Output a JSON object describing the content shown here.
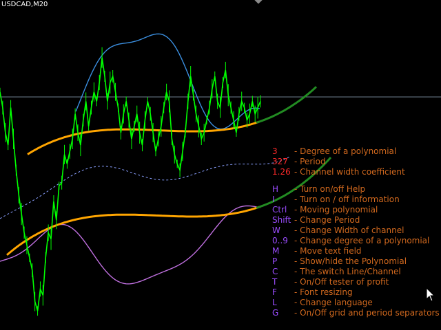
{
  "symbol": "USDCAD,M20",
  "params": [
    {
      "key": "3",
      "desc": "- Degree of a polynomial"
    },
    {
      "key": "327",
      "desc": "- Period"
    },
    {
      "key": "1.26",
      "desc": "- Channel width coefficient"
    }
  ],
  "help": [
    {
      "key": "H",
      "desc": "- Turn on/off Help"
    },
    {
      "key": "I",
      "desc": "- Turn on / off information"
    },
    {
      "key": "Ctrl",
      "desc": "- Moving polynomial"
    },
    {
      "key": "Shift",
      "desc": "- Change Period"
    },
    {
      "key": "W",
      "desc": "- Change Width of channel"
    },
    {
      "key": "0..9",
      "desc": "- Change degree of a polynomial"
    },
    {
      "key": "M",
      "desc": "- Move text field"
    },
    {
      "key": "P",
      "desc": "- Show/hide the Polynomial"
    },
    {
      "key": "C",
      "desc": "- The switch Line/Channel"
    },
    {
      "key": "T",
      "desc": "- On/Off tester of profit"
    },
    {
      "key": "F",
      "desc": "- Font resizing"
    },
    {
      "key": "L",
      "desc": "- Change language"
    },
    {
      "key": "G",
      "desc": "- On/Off grid and period separators"
    }
  ],
  "colors": {
    "background": "#000000",
    "price": "#00ff00",
    "channel": "#ffa500",
    "extension": "#228b22",
    "envelope_upper": "#3b8fe0",
    "envelope_lower": "#c070e0",
    "midline": "#8aa0ff",
    "param_key": "#ff2a2a",
    "help_key": "#9b4dff",
    "help_text": "#d2691e",
    "level_line": "#708090"
  },
  "chart_data": {
    "type": "line",
    "series": [
      {
        "values": [
          0.75,
          0.7,
          0.62,
          0.58,
          0.7,
          0.6,
          0.5,
          0.42,
          0.36,
          0.3,
          0.26,
          0.22,
          0.18,
          0.08,
          0.05,
          0.12,
          0.1,
          0.22,
          0.3,
          0.28,
          0.4,
          0.34,
          0.45,
          0.46,
          0.55,
          0.52,
          0.56,
          0.6,
          0.68,
          0.62,
          0.58,
          0.66,
          0.72,
          0.64,
          0.7,
          0.75,
          0.72,
          0.78,
          0.86,
          0.8,
          0.72,
          0.78,
          0.8,
          0.75,
          0.7,
          0.62,
          0.68,
          0.72,
          0.66,
          0.6,
          0.64,
          0.68,
          0.62,
          0.58,
          0.66,
          0.72,
          0.68,
          0.62,
          0.56,
          0.6,
          0.64,
          0.7,
          0.75,
          0.72,
          0.6,
          0.55,
          0.52,
          0.5,
          0.56,
          0.62,
          0.72,
          0.8,
          0.74,
          0.68,
          0.64,
          0.6,
          0.62,
          0.66,
          0.7,
          0.76,
          0.8,
          0.72,
          0.7,
          0.78,
          0.82,
          0.74,
          0.7,
          0.66,
          0.62,
          0.68,
          0.72,
          0.7,
          0.66,
          0.68,
          0.72,
          0.68,
          0.7,
          0.72
        ]
      }
    ],
    "degree": 3,
    "period": 327,
    "width_coefficient": 1.26
  }
}
